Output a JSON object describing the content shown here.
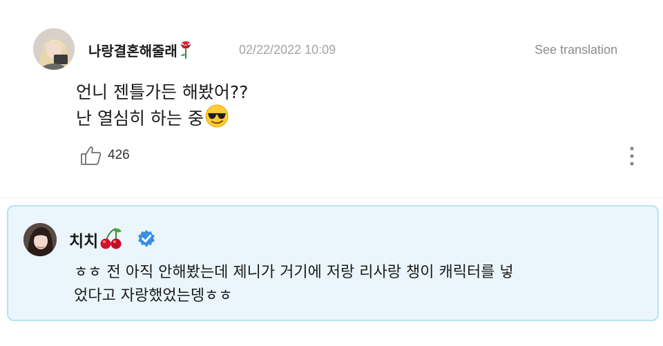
{
  "post": {
    "author_name": "나랑결혼해줄래",
    "author_emoji_icon": "rose-icon",
    "date": "02/22/2022 10:09",
    "translate_label": "See translation",
    "text_line1": "언니 젠틀가든 해봤어??",
    "text_line2": "난 열심히 하는 중",
    "text_line2_emoji_icon": "sunglasses-face-icon",
    "like_count": "426",
    "like_icon": "thumbs-up-icon",
    "more_icon": "more-vertical-icon"
  },
  "reply": {
    "author_name": "치치",
    "author_emoji_icon": "cherries-icon",
    "verified_icon": "verified-badge-icon",
    "text_line1": "ㅎㅎ 전 아직 안해봤는데 제니가 거기에 저랑 리사랑 챙이 캐릭터를 넣",
    "text_line2": "었다고 자랑했었는뎅ㅎㅎ"
  },
  "colors": {
    "reply_background": "#eaf6fc",
    "reply_border": "#b8e2f2",
    "verified_blue": "#3a8fe0",
    "date_gray": "#a3a3a3",
    "translate_gray": "#8c8c8c"
  }
}
